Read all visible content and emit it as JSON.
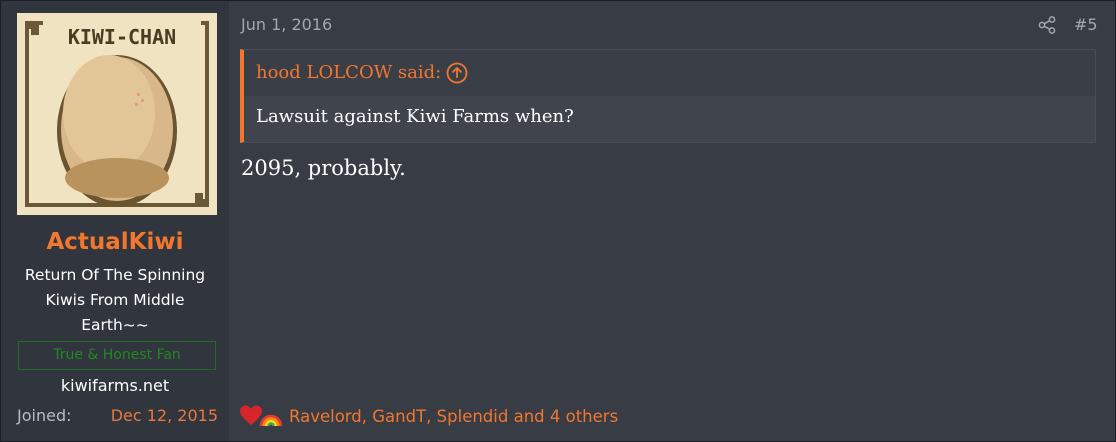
{
  "user": {
    "avatar_caption": "KIWI-CHAN",
    "username": "ActualKiwi",
    "title": "Return Of The Spinning Kiwis From Middle Earth~~",
    "banner": "True & Honest Fan",
    "site": "kiwifarms.net",
    "joined_label": "Joined:",
    "joined_value": "Dec 12, 2015"
  },
  "post": {
    "date": "Jun 1, 2016",
    "number": "#5",
    "share_icon": "share-icon",
    "quote": {
      "author": "hood LOLCOW said:",
      "text": "Lawsuit against Kiwi Farms when?"
    },
    "body": "2095, probably.",
    "reactions": {
      "icons": [
        "heart-icon",
        "rainbow-icon"
      ],
      "text": "Ravelord, GandT, Splendid and 4 others"
    }
  },
  "colors": {
    "accent": "#f2772e",
    "background": "#383c45",
    "sidebar": "#31353d",
    "banner_green": "#1f8a1f"
  }
}
